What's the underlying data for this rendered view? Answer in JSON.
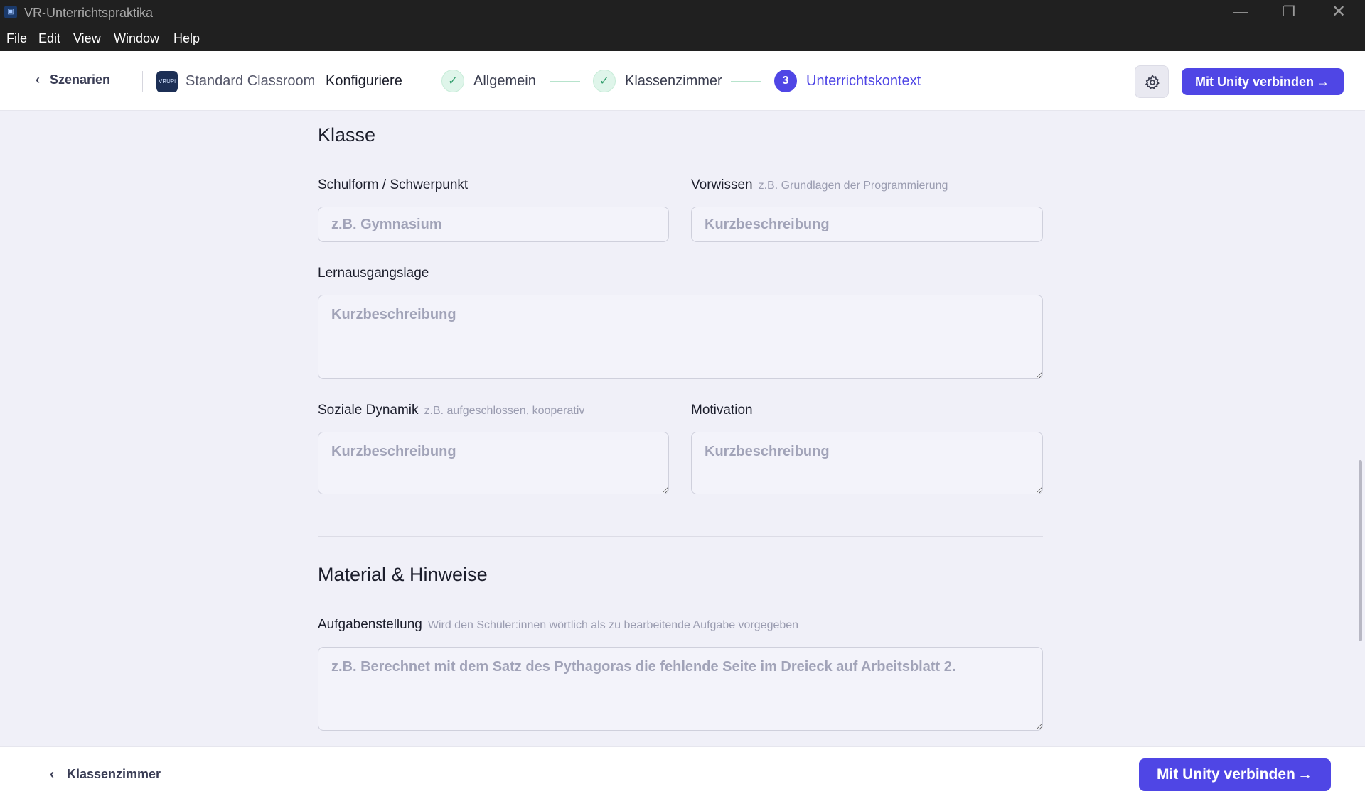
{
  "window": {
    "title": "VR-Unterrichtspraktika",
    "controls": {
      "minimize": "—",
      "maximize": "❐",
      "close": "✕"
    }
  },
  "menu": [
    "File",
    "Edit",
    "View",
    "Window",
    "Help"
  ],
  "header": {
    "back_label": "Szenarien",
    "logo_text": "VRUPi",
    "scenario_name": "Standard Classroom",
    "mode": "Konfiguriere",
    "steps": [
      {
        "label": "Allgemein",
        "state": "done"
      },
      {
        "label": "Klassenzimmer",
        "state": "done"
      },
      {
        "number": "3",
        "label": "Unterrichtskontext",
        "state": "active"
      }
    ],
    "connect_label": "Mit Unity verbinden",
    "accent_color": "#4f46e5"
  },
  "sections": {
    "klasse": {
      "title": "Klasse",
      "schulform": {
        "label": "Schulform / Schwerpunkt",
        "placeholder": "z.B. Gymnasium",
        "value": ""
      },
      "vorwissen": {
        "label": "Vorwissen",
        "hint": "z.B. Grundlagen der Programmierung",
        "placeholder": "Kurzbeschreibung",
        "value": ""
      },
      "lernausgangslage": {
        "label": "Lernausgangslage",
        "placeholder": "Kurzbeschreibung",
        "value": ""
      },
      "soziale_dynamik": {
        "label": "Soziale Dynamik",
        "hint": "z.B. aufgeschlossen, kooperativ",
        "placeholder": "Kurzbeschreibung",
        "value": ""
      },
      "motivation": {
        "label": "Motivation",
        "placeholder": "Kurzbeschreibung",
        "value": ""
      }
    },
    "material": {
      "title": "Material & Hinweise",
      "aufgabenstellung": {
        "label": "Aufgabenstellung",
        "hint": "Wird den Schüler:innen wörtlich als zu bearbeitende Aufgabe vorgegeben",
        "placeholder": "z.B. Berechnet mit dem Satz des Pythagoras die fehlende Seite im Dreieck auf Arbeitsblatt 2.",
        "value": ""
      }
    }
  },
  "footer": {
    "back_label": "Klassenzimmer",
    "connect_label": "Mit Unity verbinden"
  }
}
